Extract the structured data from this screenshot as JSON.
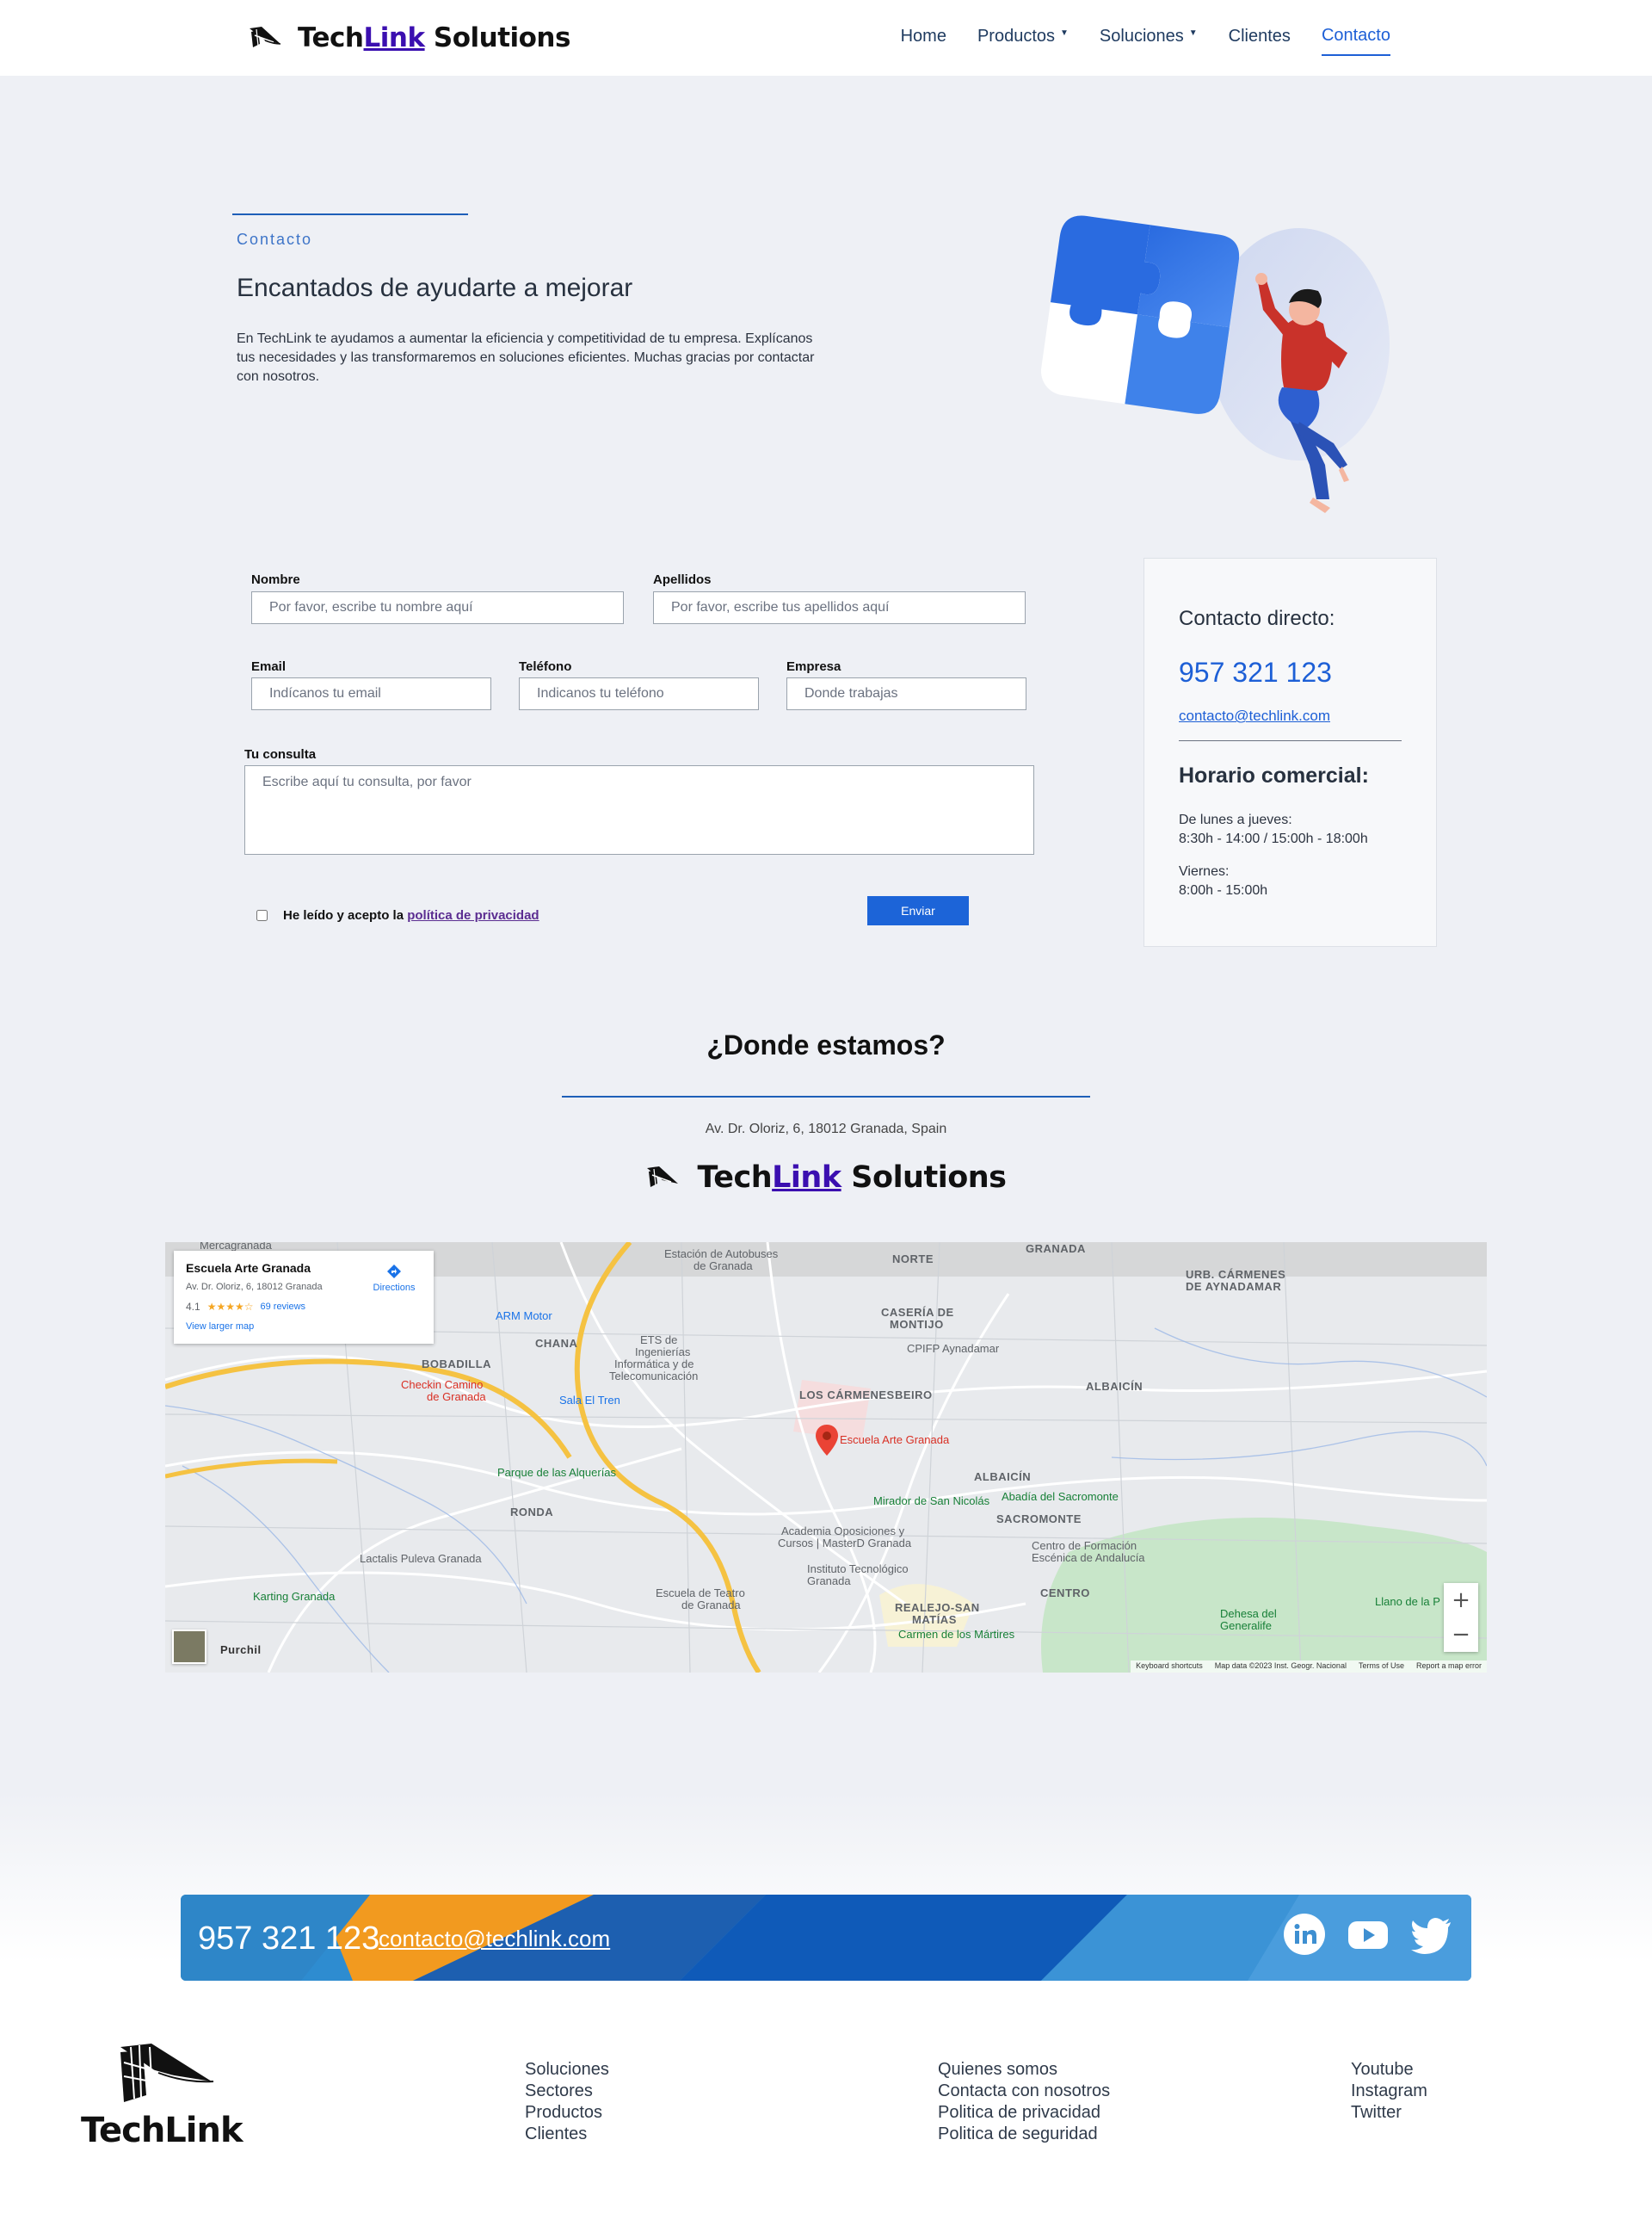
{
  "brand": {
    "name_part1": "Tech",
    "name_part2": "Link",
    "name_part3": " Solutions"
  },
  "nav": {
    "home": "Home",
    "productos": "Productos",
    "soluciones": "Soluciones",
    "clientes": "Clientes",
    "contacto": "Contacto"
  },
  "hero": {
    "eyebrow": "Contacto",
    "title": "Encantados de ayudarte a mejorar",
    "text": "En TechLink te ayudamos a aumentar la eficiencia y competitividad de tu empresa. Explícanos tus necesidades y las transformaremos en soluciones eficientes. Muchas gracias por contactar con nosotros."
  },
  "form": {
    "nombre_label": "Nombre",
    "nombre_placeholder": "Por favor, escribe tu nombre aquí",
    "apellidos_label": "Apellidos",
    "apellidos_placeholder": "Por favor, escribe tus apellidos aquí",
    "email_label": "Email",
    "email_placeholder": "Indícanos tu email",
    "telefono_label": "Teléfono",
    "telefono_placeholder": "Indicanos tu teléfono",
    "empresa_label": "Empresa",
    "empresa_placeholder": "Donde trabajas",
    "consulta_label": "Tu consulta",
    "consulta_placeholder": "Escribe aquí tu consulta, por favor",
    "privacy_text": "He leído y acepto la",
    "privacy_link": "política de privacidad",
    "submit": "Enviar"
  },
  "contact_card": {
    "title": "Contacto directo:",
    "phone": "957 321 123",
    "email": "contacto@techlink.com",
    "hours_title": "Horario comercial:",
    "sched1_days": "De lunes a jueves:",
    "sched1_hours": "8:30h - 14:00 / 15:00h - 18:00h",
    "sched2_days": "Viernes:",
    "sched2_hours": "8:00h - 15:00h"
  },
  "location": {
    "title": "¿Donde estamos?",
    "address": "Av. Dr. Oloriz, 6, 18012 Granada, Spain"
  },
  "map": {
    "place_name": "Escuela Arte Granada",
    "place_address": "Av. Dr. Oloriz, 6, 18012 Granada",
    "rating": "4.1",
    "stars": "★★★★☆",
    "reviews": "69 reviews",
    "directions": "Directions",
    "larger_map": "View larger map",
    "pin_label": "Escuela Arte Granada",
    "labels": {
      "norte": "NORTE",
      "granada": "GRANADA",
      "urb_carmenes": "URB. CÁRMENES",
      "de_aynadamar": "DE AYNADAMAR",
      "caseria": "CASERÍA DE",
      "montijo": "MONTIJO",
      "chana": "CHANA",
      "bobadilla": "BOBADILLA",
      "carmenes_beiro": "LOS CÁRMENES",
      "beiro": "BEIRO",
      "albaicin1": "ALBAICÍN",
      "albaicin2": "ALBAICÍN",
      "ronda": "RONDA",
      "sacromonte": "SACROMONTE",
      "centro": "CENTRO",
      "realejo": "REALEJO-SAN",
      "matias": "MATÍAS",
      "purchil": "Purchil"
    },
    "pois": {
      "mercagranada": "Mercagranada",
      "estacion": "Estación de Autobuses",
      "estacion2": "de Granada",
      "arm": "ARM Motor",
      "ets": "ETS de",
      "ets2": "Ingenierías",
      "ets3": "Informática y de",
      "ets4": "Telecomunicación",
      "cpifp": "CPIFP Aynadamar",
      "checkin": "Checkin Camino",
      "checkin2": "de Granada",
      "sala": "Sala El Tren",
      "alquerias": "Parque de las Alquerías",
      "mirador": "Mirador de San Nicolás",
      "abadia": "Abadía del Sacromonte",
      "academia": "Academia Oposiciones y",
      "academia2": "Cursos | MasterD Granada",
      "formacion": "Centro de Formación",
      "formacion2": "Escénica de Andalucía",
      "lactalis": "Lactalis Puleva Granada",
      "instituto": "Instituto Tecnológico",
      "instituto2": "Granada",
      "karting": "Karting Granada",
      "teatro": "Escuela de Teatro",
      "teatro2": "de Granada",
      "martires": "Carmen de los Mártires",
      "dehesa": "Dehesa del",
      "dehesa2": "Generalife",
      "llano": "Llano de la P"
    },
    "zoom_in": "+",
    "zoom_out": "−",
    "attrib_shortcuts": "Keyboard shortcuts",
    "attrib_data": "Map data ©2023 Inst. Geogr. Nacional",
    "attrib_terms": "Terms of Use",
    "attrib_report": "Report a map error"
  },
  "banner": {
    "phone": "957 321 123",
    "email": "contacto@techlink.com"
  },
  "footer": {
    "logo_text": "TechLink",
    "col1": [
      "Soluciones",
      "Sectores",
      "Productos",
      "Clientes"
    ],
    "col2": [
      "Quienes somos",
      "Contacta con nosotros",
      "Politica de privacidad",
      "Politica de seguridad"
    ],
    "col3": [
      "Youtube",
      "Instagram",
      "Twitter"
    ]
  },
  "colors": {
    "accent": "#1d5fd6",
    "brand_link": "#3b0fb0",
    "page_bg": "#eef0f5"
  },
  "icons": {
    "social": [
      "linkedin-icon",
      "youtube-icon",
      "twitter-icon"
    ]
  }
}
